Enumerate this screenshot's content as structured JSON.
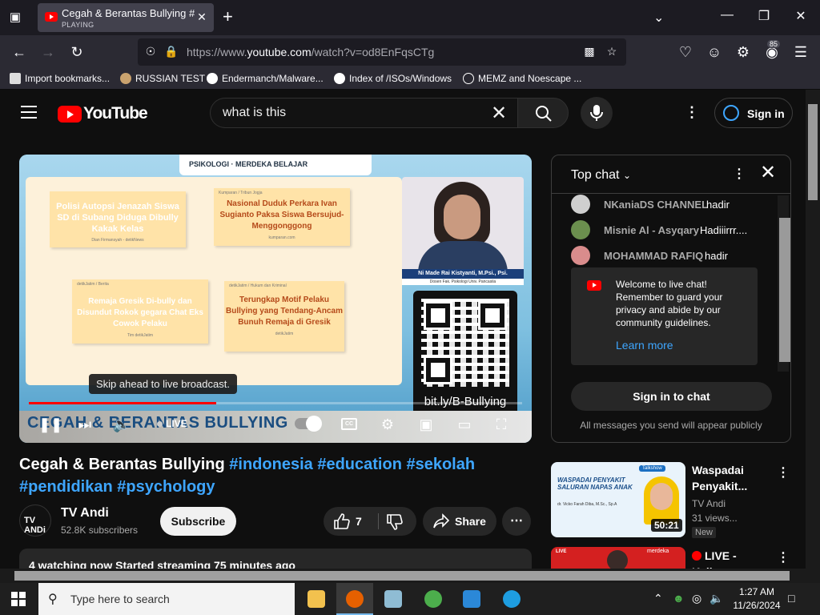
{
  "browser": {
    "tab": {
      "title": "Cegah & Berantas Bullying #indonesia",
      "status": "PLAYING"
    },
    "url": {
      "prefix": "https://www.",
      "domain": "youtube.com",
      "path": "/watch?v=od8EnFqsCTg"
    },
    "extensions_badge": "85",
    "bookmarks": [
      {
        "label": "Import bookmarks..."
      },
      {
        "label": "RUSSIAN TEST"
      },
      {
        "label": "Endermanch/Malware..."
      },
      {
        "label": "Index of /ISOs/Windows"
      },
      {
        "label": "MEMZ and Noescape ..."
      }
    ]
  },
  "youtube": {
    "logo_text": "YouTube",
    "search_value": "what is this",
    "sign_in_label": "Sign in",
    "player": {
      "slide": {
        "header_text": "PSIKOLOGI · MERDEKA BELAJAR",
        "cards": [
          {
            "tag": "",
            "title": "Polisi Autopsi Jenazah Siswa SD di Subang Diduga Dibully Kakak Kelas",
            "meta": "Dian Firmansyah - detikNews"
          },
          {
            "tag": "Kumparan / Tribun Jogja",
            "title": "Nasional Duduk Perkara Ivan Sugianto Paksa Siswa Bersujud-Menggonggong",
            "meta": "kumparan.com"
          },
          {
            "tag": "detikJatim / Berita",
            "title": "Remaja Gresik Di-bully dan Disundut Rokok gegara Chat Eks Cowok Pelaku",
            "meta": "Tim detikJatim"
          },
          {
            "tag": "detikJatim / Hukum dan Kriminal",
            "title": "Terungkap Motif Pelaku Bullying yang Tendang-Ancam Bunuh Remaja di Gresik",
            "meta": "detikJatim"
          }
        ],
        "speaker_name": "Ni Made Rai Kistyanti, M.Psi., Psi.",
        "speaker_role": "Dosen Fak. Psikologi Univ. Pancasila",
        "qr_caption": "bit.ly/B-Bullying",
        "banner_title": "CEGAH & BERANTAS BULLYING"
      },
      "tooltip": "Skip ahead to live broadcast.",
      "live_label": "LIVE",
      "cc_label": "CC",
      "progress": 0.38
    },
    "video": {
      "title_text": "Cegah & Berantas Bullying",
      "hashtags_line1": [
        "#indonesia",
        "#education",
        "#sekolah"
      ],
      "hashtags_line2": [
        "#pendidikan",
        "#psychology"
      ],
      "channel_name": "TV Andi",
      "channel_avatar_text": "TV ANDi",
      "subscribers": "52.8K subscribers",
      "subscribe_label": "Subscribe",
      "like_count": "7",
      "share_label": "Share",
      "description": "4 watching now  Started streaming 75 minutes ago"
    },
    "chat": {
      "header": "Top chat",
      "messages": [
        {
          "author": "NKaniaDS CHANNEL",
          "text": "hadir",
          "avatar_color": "#cfcfcf"
        },
        {
          "author": "Misnie Al - Asyqary",
          "text": "Hadiiirrr....",
          "avatar_color": "#6b8f4e"
        },
        {
          "author": "MOHAMMAD RAFIQ",
          "text": "hadir",
          "avatar_color": "#d98c8c"
        }
      ],
      "welcome_text": "Welcome to live chat! Remember to guard your privacy and abide by our community guidelines.",
      "learn_more": "Learn more",
      "sign_in_chat": "Sign in to chat",
      "footer": "All messages you send will appear publicly"
    },
    "recommendations": [
      {
        "title": "Waspadai Penyakit...",
        "channel": "TV Andi",
        "views": "31 views...",
        "badge": "New",
        "duration": "50:21",
        "thumb_tag": "Talkshow",
        "thumb_title": "WASPADAI PENYAKIT SALURAN NAPAS ANAK",
        "thumb_guest": "dr. Vicko Farah Diba, M.Sc., Sp.A"
      },
      {
        "title": "LIVE - Kajian...",
        "thumb_tag": "LIVE",
        "thumb_brand": "merdeka"
      }
    ]
  },
  "taskbar": {
    "search_placeholder": "Type here to search",
    "time": "1:27 AM",
    "date": "11/26/2024"
  }
}
